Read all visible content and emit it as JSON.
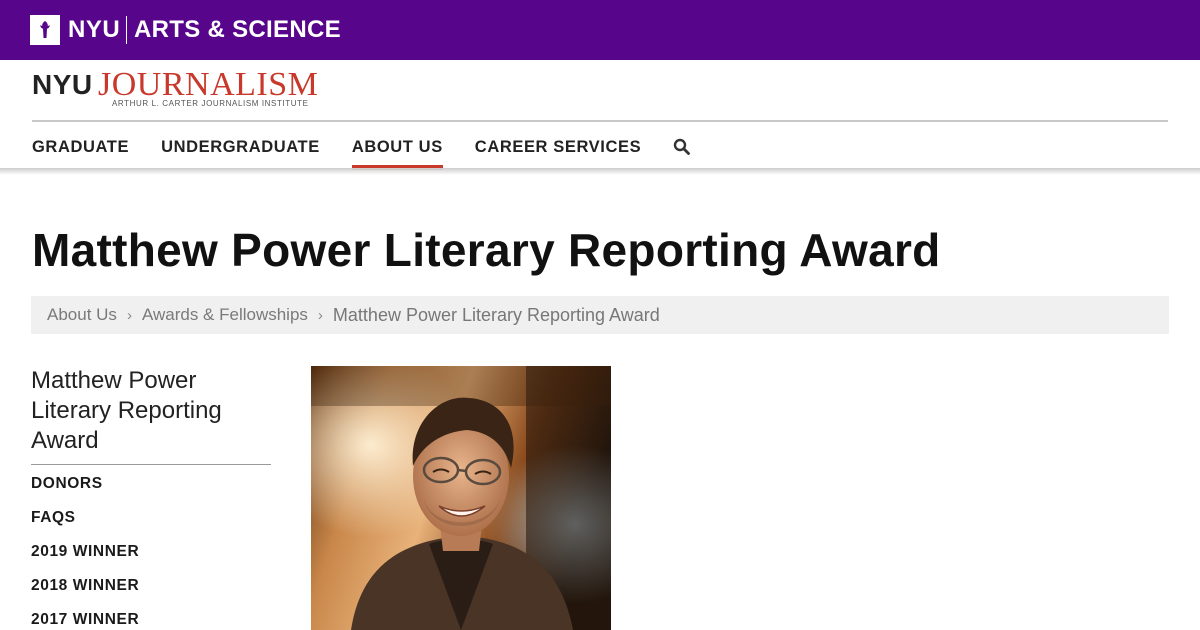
{
  "topbar": {
    "university": "NYU",
    "school": "ARTS & SCIENCE",
    "background": "#57068c"
  },
  "logo": {
    "nyu": "NYU",
    "journalism": "JOURNALISM",
    "subtitle": "ARTHUR L. CARTER JOURNALISM INSTITUTE"
  },
  "nav": {
    "items": [
      {
        "label": "GRADUATE",
        "active": false
      },
      {
        "label": "UNDERGRADUATE",
        "active": false
      },
      {
        "label": "ABOUT US",
        "active": true
      },
      {
        "label": "CAREER SERVICES",
        "active": false
      }
    ],
    "search_icon": "search-icon",
    "accent": "#c8392b"
  },
  "page": {
    "title": "Matthew Power Literary Reporting Award"
  },
  "breadcrumb": {
    "items": [
      "About Us",
      "Awards & Fellowships",
      "Matthew Power Literary Reporting Award"
    ],
    "separator": "›"
  },
  "sidebar": {
    "title": "Matthew Power Literary Reporting Award",
    "links": [
      "DONORS",
      "FAQS",
      "2019 WINNER",
      "2018 WINNER",
      "2017 WINNER"
    ]
  },
  "photo": {
    "subject": "portrait photo of a smiling man with glasses"
  }
}
